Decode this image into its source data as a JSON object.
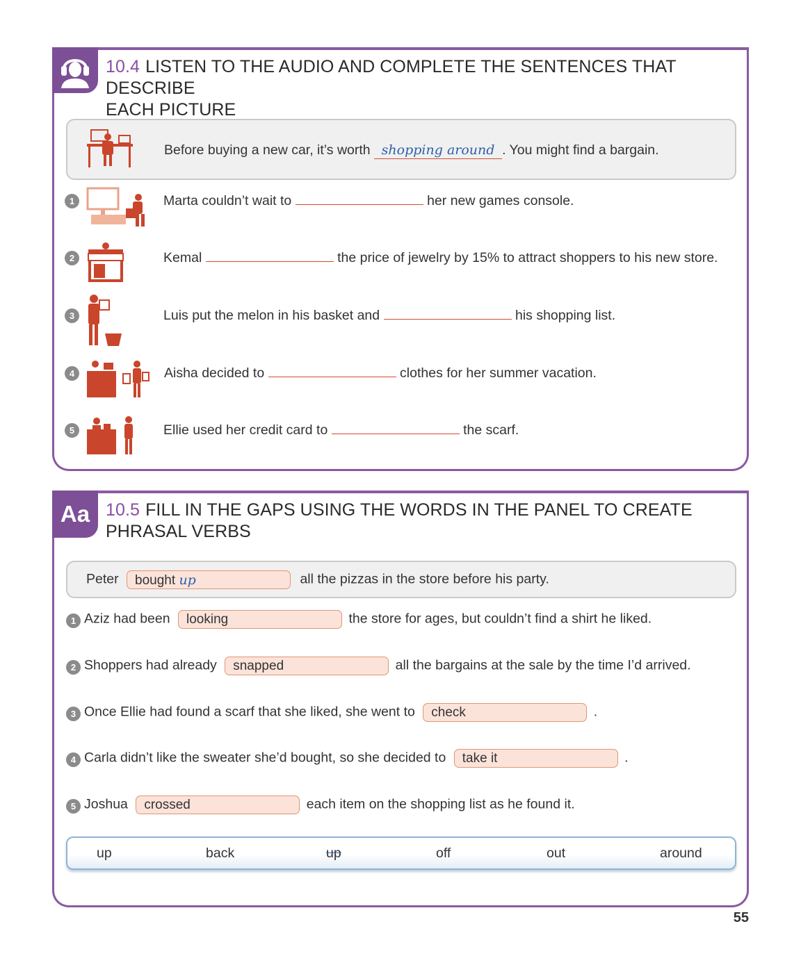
{
  "ex1": {
    "number": "10.4",
    "title_line1": "LISTEN TO THE AUDIO AND COMPLETE THE SENTENCES THAT DESCRIBE",
    "title_line2": "EACH PICTURE",
    "icon": "headphones-person-icon",
    "example": {
      "before": "Before buying a new car, it’s worth",
      "answer": "shopping around",
      "after": ". You might find a bargain."
    },
    "items": [
      {
        "n": "1",
        "before": "Marta couldn’t wait to",
        "after": "her new games console."
      },
      {
        "n": "2",
        "before": "Kemal",
        "after": "the price of  jewelry by 15% to attract shoppers to his new store."
      },
      {
        "n": "3",
        "before": "Luis put the melon in his basket and",
        "after": "his shopping list."
      },
      {
        "n": "4",
        "before": "Aisha decided to",
        "after": "clothes for her summer vacation."
      },
      {
        "n": "5",
        "before": "Ellie used her credit card to",
        "after": "the scarf."
      }
    ]
  },
  "ex2": {
    "number": "10.5",
    "tab_label": "Aa",
    "title_line1": "FILL IN THE GAPS USING THE WORDS IN THE PANEL TO CREATE",
    "title_line2": "PHRASAL VERBS",
    "example": {
      "before": "Peter",
      "printed": "bought",
      "answer": "up",
      "after": "all the pizzas in the store before his party."
    },
    "items": [
      {
        "n": "1",
        "before": "Aziz had been",
        "fill": "looking",
        "after": "the store for ages, but couldn’t find a shirt he liked."
      },
      {
        "n": "2",
        "before": "Shoppers had already",
        "fill": "snapped",
        "after": "all the bargains at the sale by the time I’d arrived."
      },
      {
        "n": "3",
        "before": "Once Ellie had found a scarf that she liked, she went to",
        "fill": "check",
        "after": "."
      },
      {
        "n": "4",
        "before": "Carla didn’t like the sweater she’d bought, so she decided to",
        "fill": "take it",
        "after": "."
      },
      {
        "n": "5",
        "before": "Joshua",
        "fill": "crossed",
        "after": "each item on the shopping list as he found it."
      }
    ],
    "panel_words": [
      "up",
      "back",
      "up",
      "off",
      "out",
      "around"
    ]
  },
  "page_number": "55",
  "colors": {
    "accent": "#8a5aa3",
    "illustration": "#c9452b",
    "pill_fill": "#fbe3da",
    "pill_border": "#e09573",
    "handwriting": "#2e5fa8"
  }
}
